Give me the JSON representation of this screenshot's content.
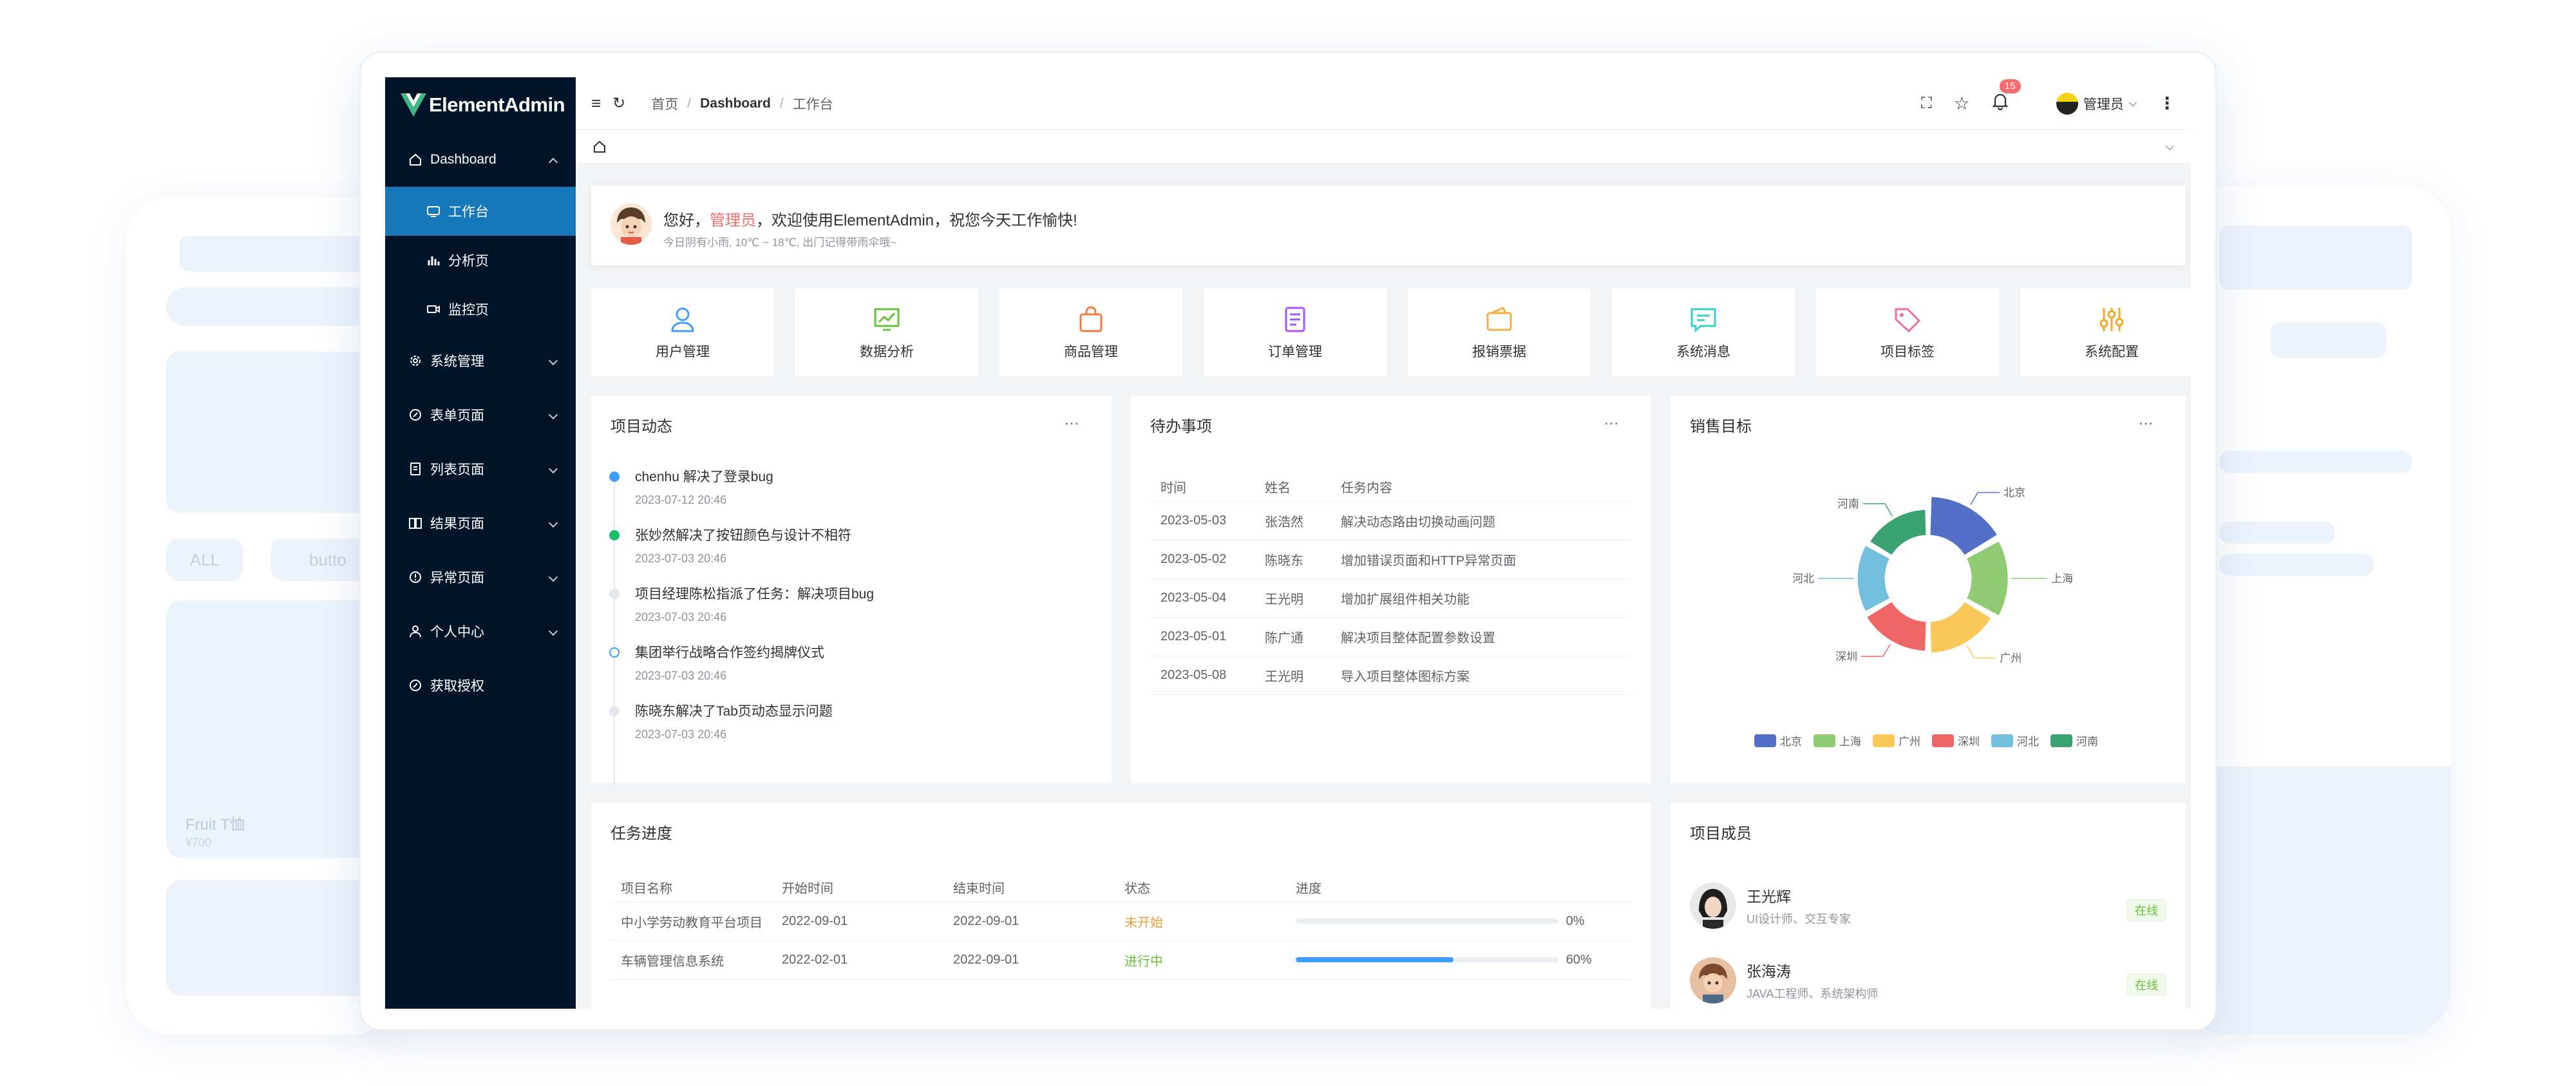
{
  "app": {
    "logo_text": "ElementAdmin"
  },
  "sidebar": {
    "items": [
      {
        "label": "Dashboard",
        "expanded": true
      },
      {
        "label": "工作台",
        "active": true
      },
      {
        "label": "分析页"
      },
      {
        "label": "监控页"
      },
      {
        "label": "系统管理"
      },
      {
        "label": "表单页面"
      },
      {
        "label": "列表页面"
      },
      {
        "label": "结果页面"
      },
      {
        "label": "异常页面"
      },
      {
        "label": "个人中心"
      },
      {
        "label": "获取授权"
      }
    ]
  },
  "header": {
    "breadcrumb": [
      "首页",
      "Dashboard",
      "工作台"
    ],
    "notification_count": "15",
    "user_name": "管理员"
  },
  "welcome": {
    "greeting_prefix": "您好，",
    "user": "管理员",
    "greeting_suffix": "，欢迎使用ElementAdmin，祝您今天工作愉快!",
    "weather": "今日阴有小雨, 10℃ ~ 18℃, 出门记得带雨伞哦~"
  },
  "quick_actions": [
    {
      "label": "用户管理",
      "icon": "user-icon",
      "color": "#409eff"
    },
    {
      "label": "数据分析",
      "icon": "chart-icon",
      "color": "#67c23a"
    },
    {
      "label": "商品管理",
      "icon": "shopping-bag-icon",
      "color": "#f27b3c"
    },
    {
      "label": "订单管理",
      "icon": "order-icon",
      "color": "#a855f7"
    },
    {
      "label": "报销票据",
      "icon": "wallet-icon",
      "color": "#f5b041"
    },
    {
      "label": "系统消息",
      "icon": "message-icon",
      "color": "#36cfc9"
    },
    {
      "label": "项目标签",
      "icon": "tag-icon",
      "color": "#eb6fa6"
    },
    {
      "label": "系统配置",
      "icon": "settings-icon",
      "color": "#f5a623"
    }
  ],
  "project_activity": {
    "title": "项目动态",
    "more": "...",
    "items": [
      {
        "text": "chenhu 解决了登录bug",
        "time": "2023-07-12 20:46",
        "dot": "#409eff"
      },
      {
        "text": "张妙然解决了按钮颜色与设计不相符",
        "time": "2023-07-03 20:46",
        "dot": "#19be6b"
      },
      {
        "text": "项目经理陈松指派了任务：解决项目bug",
        "time": "2023-07-03 20:46",
        "dot": "#e4e7ed"
      },
      {
        "text": "集团举行战略合作签约揭牌仪式",
        "time": "2023-07-03 20:46",
        "dot": "hollow"
      },
      {
        "text": "陈晓东解决了Tab页动态显示问题",
        "time": "2023-07-03 20:46",
        "dot": "#e4e7ed"
      }
    ]
  },
  "todo": {
    "title": "待办事项",
    "more": "...",
    "columns": [
      "时间",
      "姓名",
      "任务内容"
    ],
    "rows": [
      [
        "2023-05-03",
        "张浩然",
        "解决动态路由切换动画问题"
      ],
      [
        "2023-05-02",
        "陈晓东",
        "增加错误页面和HTTP异常页面"
      ],
      [
        "2023-05-04",
        "王光明",
        "增加扩展组件相关功能"
      ],
      [
        "2023-05-01",
        "陈广通",
        "解决项目整体配置参数设置"
      ],
      [
        "2023-05-08",
        "王光明",
        "导入项目整体图标方案"
      ]
    ]
  },
  "sales": {
    "title": "销售目标",
    "more": "..."
  },
  "chart_data": {
    "type": "pie",
    "variant": "rose-donut",
    "title": "",
    "categories": [
      "北京",
      "上海",
      "广州",
      "深圳",
      "河北",
      "河南"
    ],
    "values": [
      40,
      38,
      32,
      30,
      28,
      26
    ],
    "colors": [
      "#5470c6",
      "#91cc75",
      "#fac858",
      "#ee6666",
      "#73c0de",
      "#3ba272"
    ],
    "legend_position": "bottom"
  },
  "progress": {
    "title": "任务进度",
    "columns": [
      "项目名称",
      "开始时间",
      "结束时间",
      "状态",
      "进度"
    ],
    "rows": [
      {
        "name": "中小学劳动教育平台项目",
        "start": "2022-09-01",
        "end": "2022-09-01",
        "status": "未开始",
        "status_color": "#e6a23c",
        "percent": 0,
        "percent_label": "0%"
      },
      {
        "name": "车辆管理信息系统",
        "start": "2022-02-01",
        "end": "2022-09-01",
        "status": "进行中",
        "status_color": "#67c23a",
        "percent": 60,
        "percent_label": "60%"
      }
    ]
  },
  "members": {
    "title": "项目成员",
    "list": [
      {
        "name": "王光辉",
        "role": "UI设计师、交互专家",
        "status": "在线"
      },
      {
        "name": "张海涛",
        "role": "JAVA工程师、系统架构师",
        "status": "在线"
      }
    ]
  },
  "background": {
    "tab_all": "ALL",
    "tab_button": "butto",
    "product_name": "Fruit T恤",
    "product_price": "¥700"
  }
}
